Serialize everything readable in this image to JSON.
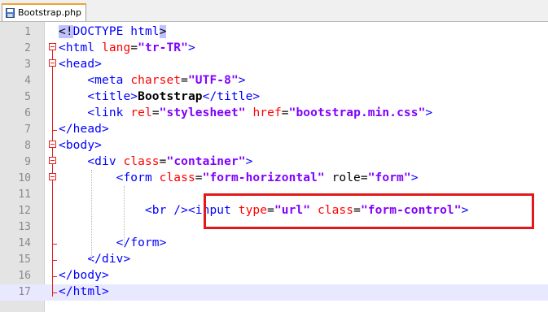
{
  "tab": {
    "filename": "Bootstrap.php"
  },
  "lines": [
    {
      "num": "1",
      "parts": [
        [
          "sel",
          "<!"
        ],
        [
          "tag",
          "DOCTYPE html"
        ],
        [
          "sel",
          ">"
        ]
      ]
    },
    {
      "num": "2",
      "parts": [
        [
          "tag",
          "<html "
        ],
        [
          "attr",
          "lang"
        ],
        [
          "plain",
          "="
        ],
        [
          "val",
          "\"tr-TR\""
        ],
        [
          "tag",
          ">"
        ]
      ]
    },
    {
      "num": "3",
      "parts": [
        [
          "tag",
          "<head>"
        ]
      ]
    },
    {
      "num": "4",
      "parts": [
        [
          "plain",
          "    "
        ],
        [
          "tag",
          "<meta "
        ],
        [
          "attr",
          "charset"
        ],
        [
          "plain",
          "="
        ],
        [
          "val",
          "\"UTF-8\""
        ],
        [
          "tag",
          ">"
        ]
      ]
    },
    {
      "num": "5",
      "parts": [
        [
          "plain",
          "    "
        ],
        [
          "tag",
          "<title>"
        ],
        [
          "txt",
          "Bootstrap"
        ],
        [
          "tag",
          "</title>"
        ]
      ]
    },
    {
      "num": "6",
      "parts": [
        [
          "plain",
          "    "
        ],
        [
          "tag",
          "<link "
        ],
        [
          "attr",
          "rel"
        ],
        [
          "plain",
          "="
        ],
        [
          "val",
          "\"stylesheet\""
        ],
        [
          "plain",
          " "
        ],
        [
          "attr",
          "href"
        ],
        [
          "plain",
          "="
        ],
        [
          "val",
          "\"bootstrap.min.css\""
        ],
        [
          "tag",
          ">"
        ]
      ]
    },
    {
      "num": "7",
      "parts": [
        [
          "tag",
          "</head>"
        ]
      ]
    },
    {
      "num": "8",
      "parts": [
        [
          "tag",
          "<body>"
        ]
      ]
    },
    {
      "num": "9",
      "parts": [
        [
          "plain",
          "    "
        ],
        [
          "tag",
          "<div "
        ],
        [
          "attr",
          "class"
        ],
        [
          "plain",
          "="
        ],
        [
          "val",
          "\"container\""
        ],
        [
          "tag",
          ">"
        ]
      ]
    },
    {
      "num": "10",
      "parts": [
        [
          "plain",
          "        "
        ],
        [
          "tag",
          "<form "
        ],
        [
          "attr",
          "class"
        ],
        [
          "plain",
          "="
        ],
        [
          "val",
          "\"form-horizontal\""
        ],
        [
          "plain",
          " role="
        ],
        [
          "val",
          "\"form\""
        ],
        [
          "tag",
          ">"
        ]
      ]
    },
    {
      "num": "11",
      "parts": []
    },
    {
      "num": "12",
      "parts": [
        [
          "plain",
          "            "
        ],
        [
          "tag",
          "<br />"
        ],
        [
          "tag",
          "<input "
        ],
        [
          "attr",
          "type"
        ],
        [
          "plain",
          "="
        ],
        [
          "val",
          "\"url\""
        ],
        [
          "plain",
          " "
        ],
        [
          "attr",
          "class"
        ],
        [
          "plain",
          "="
        ],
        [
          "val",
          "\"form-control\""
        ],
        [
          "tag",
          ">"
        ]
      ]
    },
    {
      "num": "13",
      "parts": []
    },
    {
      "num": "14",
      "parts": [
        [
          "plain",
          "        "
        ],
        [
          "tag",
          "</form>"
        ]
      ]
    },
    {
      "num": "15",
      "parts": [
        [
          "plain",
          "    "
        ],
        [
          "tag",
          "</div>"
        ]
      ]
    },
    {
      "num": "16",
      "parts": [
        [
          "tag",
          "</body>"
        ]
      ]
    },
    {
      "num": "17",
      "parts": [
        [
          "tag",
          "</html>"
        ]
      ]
    }
  ]
}
